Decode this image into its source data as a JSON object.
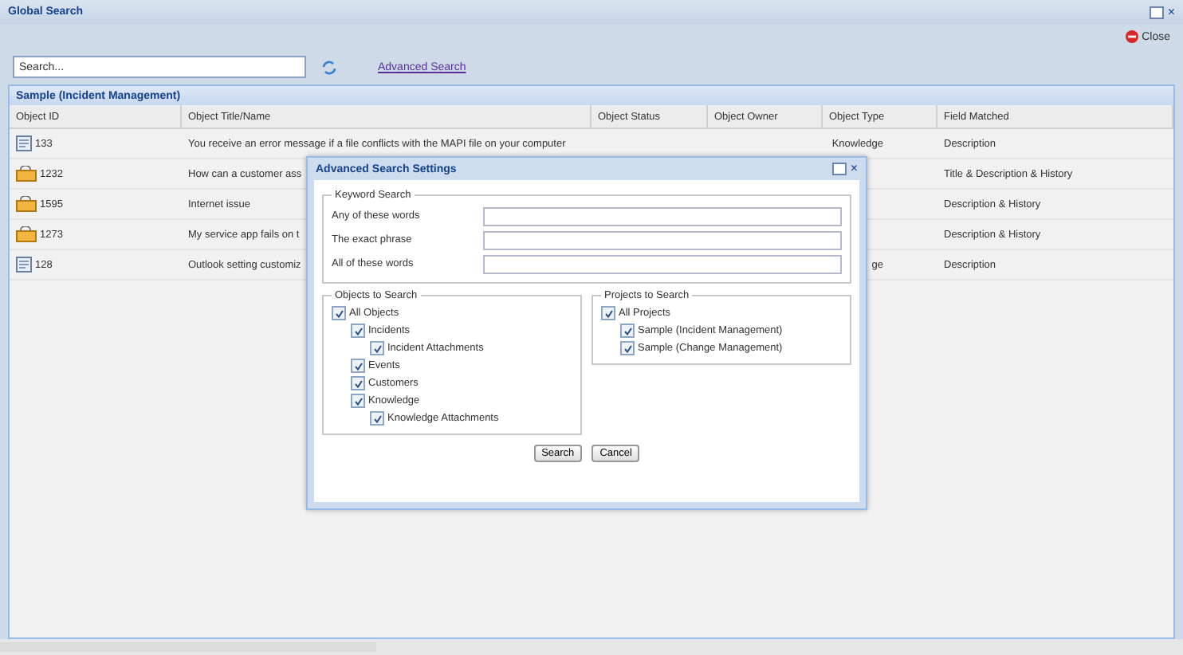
{
  "window": {
    "title": "Global Search",
    "close": "×"
  },
  "toolbar": {
    "close": "Close"
  },
  "search": {
    "placeholder": "Search...",
    "advanced_link": "Advanced Search"
  },
  "group": {
    "title": "Sample (Incident Management)"
  },
  "table": {
    "columns": [
      "Object ID",
      "Object Title/Name",
      "Object Status",
      "Object Owner",
      "Object Type",
      "Field Matched"
    ],
    "rows": [
      {
        "kind": "document",
        "id": "133",
        "title": "You receive an error message if a file conflicts with the MAPI file on your computer",
        "type": "Knowledge",
        "field": "Description"
      },
      {
        "kind": "folder",
        "id": "1232",
        "title": "How can a customer ass",
        "type": "",
        "field": "Title & Description & History"
      },
      {
        "kind": "folder",
        "id": "1595",
        "title": "Internet issue",
        "type": "",
        "field": "Description & History"
      },
      {
        "kind": "folder",
        "id": "1273",
        "title": "My service app fails on t",
        "type": "",
        "field": "Description & History"
      },
      {
        "kind": "document",
        "id": "128",
        "title": "Outlook setting customiz",
        "type": "ge",
        "field": "Description"
      }
    ]
  },
  "dialog": {
    "title": "Advanced Search Settings",
    "close": "×",
    "keyword": {
      "legend": "Keyword Search",
      "fields": [
        "Any of these words",
        "The exact phrase",
        "All of these words"
      ]
    },
    "objects": {
      "legend": "Objects to Search",
      "items": [
        {
          "label": "All Objects",
          "checked": true,
          "children": [
            {
              "label": "Incidents",
              "checked": true,
              "children": [
                {
                  "label": "Incident Attachments",
                  "checked": true
                }
              ]
            },
            {
              "label": "Events",
              "checked": true
            },
            {
              "label": "Customers",
              "checked": true
            },
            {
              "label": "Knowledge",
              "checked": true,
              "children": [
                {
                  "label": "Knowledge Attachments",
                  "checked": true
                }
              ]
            }
          ]
        }
      ]
    },
    "projects": {
      "legend": "Projects to Search",
      "items": [
        {
          "label": "All Projects",
          "checked": true,
          "children": [
            {
              "label": "Sample (Incident Management)",
              "checked": true
            },
            {
              "label": "Sample (Change Management)",
              "checked": true
            }
          ]
        }
      ]
    },
    "buttons": [
      "Search",
      "Cancel"
    ]
  }
}
